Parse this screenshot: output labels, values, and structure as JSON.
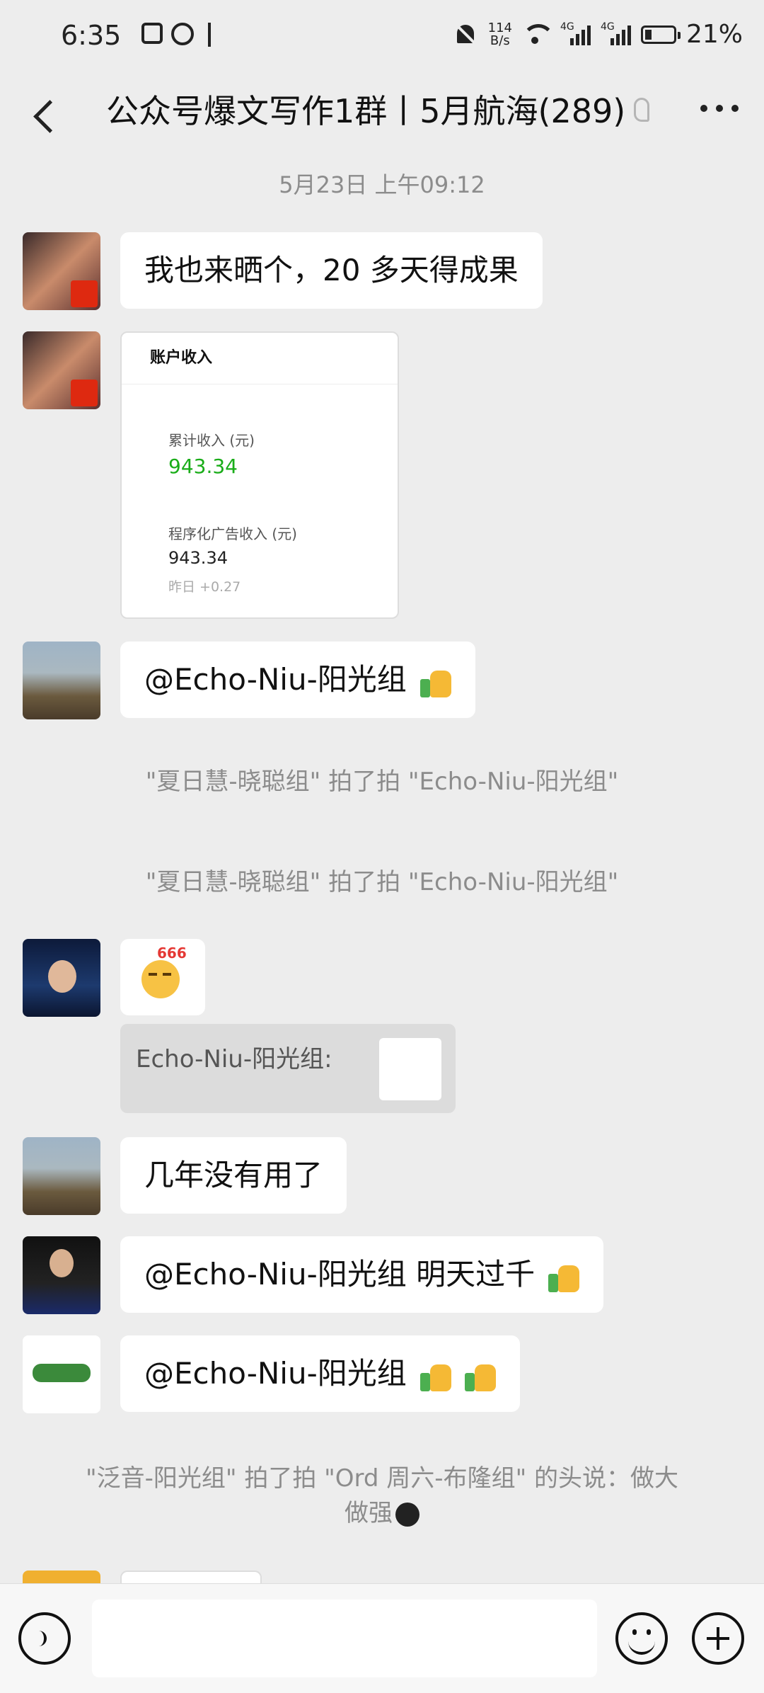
{
  "status_bar": {
    "time": "6:35",
    "net_speed_value": "114",
    "net_speed_unit": "B/s",
    "sim1": "4G",
    "sim2": "4G",
    "battery": "21%"
  },
  "header": {
    "title": "公众号爆文写作1群丨5月航海(289)"
  },
  "timestamp": "5月23日 上午09:12",
  "messages": {
    "m1": "我也来晒个，20 多天得成果",
    "card": {
      "header": "账户收入",
      "label1": "累计收入 (元)",
      "value1": "943.34",
      "label2": "程序化广告收入 (元)",
      "value2": "943.34",
      "value3": "昨日 +0.27"
    },
    "m3": "@Echo-Niu-阳光组",
    "pat1": "\"夏日慧-晓聪组\" 拍了拍 \"Echo-Niu-阳光组\"",
    "pat2": "\"夏日慧-晓聪组\" 拍了拍 \"Echo-Niu-阳光组\"",
    "emoji_tag": "666",
    "quote": "Echo-Niu-阳光组:",
    "m5": "几年没有用了",
    "m6": "@Echo-Niu-阳光组   明天过千",
    "m7": "@Echo-Niu-阳光组",
    "pat3_line1": "\"泛音-阳光组\" 拍了拍 \"Ord 周六-布隆组\" 的头说：做大",
    "pat3_line2": "做强"
  },
  "colors": {
    "accent_green": "#1aad19",
    "background": "#ededed"
  }
}
